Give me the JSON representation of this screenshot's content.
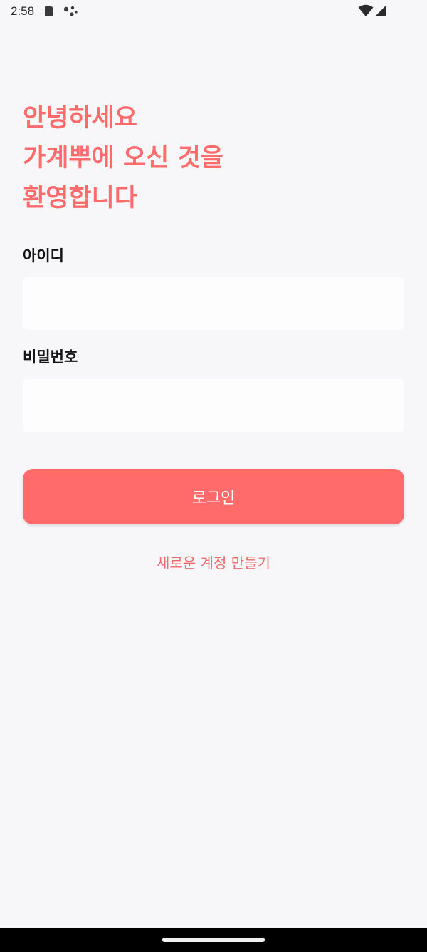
{
  "status_bar": {
    "time": "2:58",
    "icons": [
      "sd-card-icon",
      "assistant-icon",
      "wifi-icon",
      "signal-icon"
    ]
  },
  "welcome": {
    "lines": [
      "안녕하세요",
      "가계뿌에 오신 것을",
      "환영합니다"
    ]
  },
  "form": {
    "id_label": "아이디",
    "id_value": "",
    "password_label": "비밀번호",
    "password_value": ""
  },
  "login_button_label": "로그인",
  "signup_link_label": "새로운 계정 만들기",
  "colors": {
    "accent": "#ff6b6b",
    "background": "#f7f7fa",
    "input_background": "#fdfdfe",
    "nav_bar": "#000000"
  }
}
